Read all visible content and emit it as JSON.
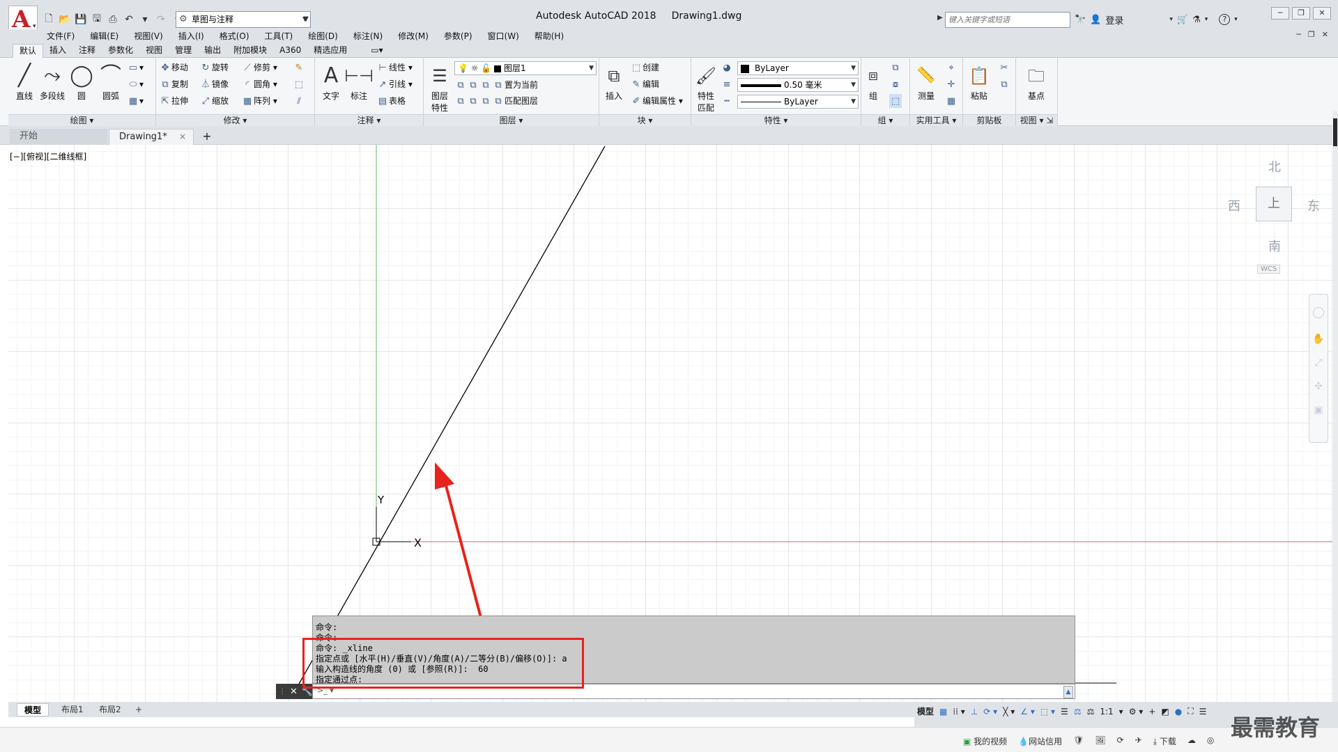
{
  "title_bar": {
    "app_name": "Autodesk AutoCAD 2018",
    "file_name": "Drawing1.dwg",
    "workspace": "草图与注释",
    "search_placeholder": "键入关键字或短语",
    "login": "登录",
    "help": "?"
  },
  "menu_items": [
    "文件(F)",
    "编辑(E)",
    "视图(V)",
    "插入(I)",
    "格式(O)",
    "工具(T)",
    "绘图(D)",
    "标注(N)",
    "修改(M)",
    "参数(P)",
    "窗口(W)",
    "帮助(H)"
  ],
  "ribbon_tabs": [
    "默认",
    "插入",
    "注释",
    "参数化",
    "视图",
    "管理",
    "输出",
    "附加模块",
    "A360",
    "精选应用"
  ],
  "ribbon": {
    "draw": {
      "title": "绘图",
      "line": "直线",
      "polyline": "多段线",
      "circle": "圆",
      "arc": "圆弧"
    },
    "modify": {
      "title": "修改",
      "move": "移动",
      "rotate": "旋转",
      "trim": "修剪",
      "copy": "复制",
      "mirror": "镜像",
      "fillet": "圆角",
      "stretch": "拉伸",
      "scale": "缩放",
      "array": "阵列"
    },
    "annotation": {
      "title": "注释",
      "text": "文字",
      "dimension": "标注",
      "linear": "线性",
      "leader": "引线",
      "table": "表格"
    },
    "layers": {
      "title": "图层",
      "layer_props_1": "图层",
      "layer_props_2": "特性",
      "current_layer": "图层1",
      "set_current": "置为当前",
      "match_layer": "匹配图层"
    },
    "block": {
      "title": "块",
      "insert": "插入",
      "create": "创建",
      "edit": "编辑",
      "edit_attr": "编辑属性"
    },
    "properties": {
      "title": "特性",
      "match_1": "特性",
      "match_2": "匹配",
      "color": "ByLayer",
      "lineweight": "0.50 毫米",
      "linetype": "ByLayer"
    },
    "groups": {
      "title": "组",
      "group": "组"
    },
    "utilities": {
      "title": "实用工具",
      "measure": "测量"
    },
    "clipboard": {
      "title": "剪贴板",
      "paste": "粘贴"
    },
    "view": {
      "title": "视图",
      "base": "基点"
    }
  },
  "doc_tabs": {
    "start": "开始",
    "drawing": "Drawing1*",
    "close": "×",
    "plus": "+"
  },
  "viewport_label": "[−][俯视][二维线框]",
  "viewcube": {
    "north": "北",
    "south": "南",
    "east": "东",
    "west": "西",
    "face": "上",
    "wcs": "WCS"
  },
  "ucs": {
    "y": "Y",
    "x": "X"
  },
  "command_lines": [
    "命令:",
    "命令:",
    "命令: _xline",
    "指定点或 [水平(H)/垂直(V)/角度(A)/二等分(B)/偏移(O)]: a",
    "输入构造线的角度 (0) 或 [参照(R)]:  60",
    "指定通过点:"
  ],
  "command_input_placeholder": "",
  "layout_tabs": [
    "模型",
    "布局1",
    "布局2"
  ],
  "status": {
    "model": "模型",
    "scale": "1:1"
  },
  "bottom_bar": [
    "我的视频",
    "网站信用",
    "下载"
  ],
  "watermark": "最需教育",
  "colors": {
    "accent_red": "#e8221c",
    "ribbon_bg": "#f5f6f8",
    "title_bg": "#dfe3e8",
    "cmd_bg": "#cbcbcb"
  }
}
